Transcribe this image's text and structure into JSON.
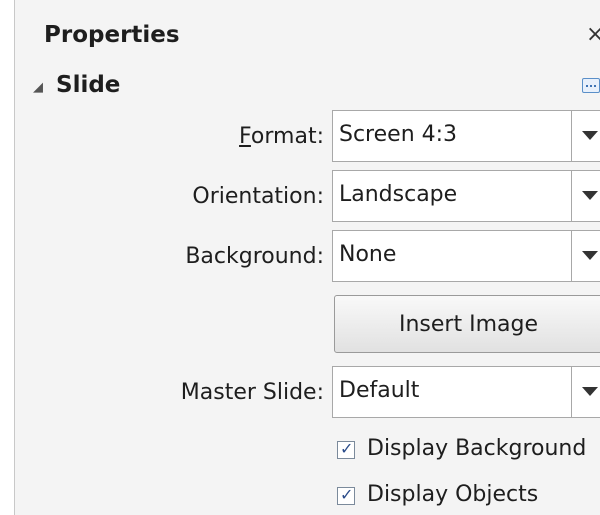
{
  "panel": {
    "title": "Properties",
    "close_glyph": "×",
    "section_arrow": "◢",
    "section_title": "Slide",
    "more_options_icon": "more-options-icon"
  },
  "fields": {
    "format": {
      "label_first": "F",
      "label_rest": "ormat:",
      "value": "Screen 4:3"
    },
    "orientation": {
      "label": "Orientation:",
      "value": "Landscape"
    },
    "background": {
      "label": "Background:",
      "value": "None"
    },
    "insert_image": {
      "label": "Insert Image"
    },
    "master_slide": {
      "label": "Master Slide:",
      "value": "Default"
    }
  },
  "checks": {
    "display_background": {
      "label": "Display Background",
      "checked": true
    },
    "display_objects": {
      "label": "Display Objects",
      "checked": true
    }
  },
  "colors": {
    "panel_bg": "#f4f4f4",
    "accent": "#3f73b4"
  }
}
